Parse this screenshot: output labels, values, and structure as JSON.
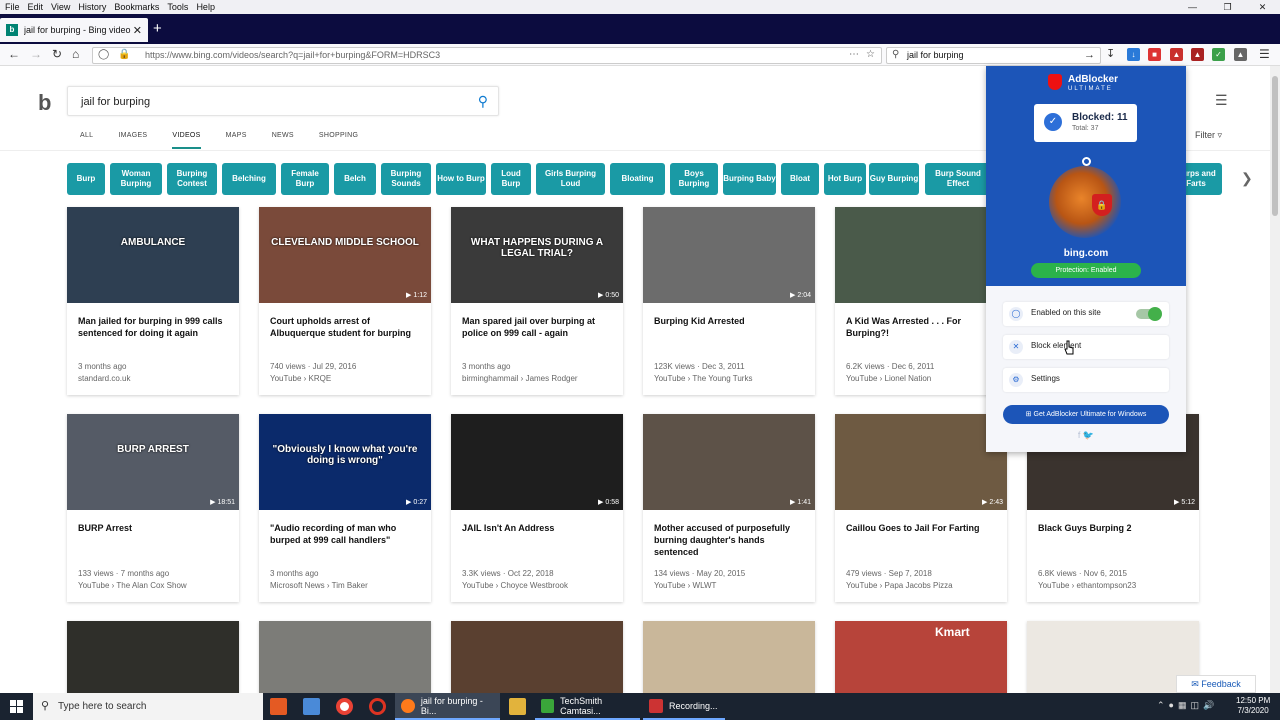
{
  "browser": {
    "menu": [
      "File",
      "Edit",
      "View",
      "History",
      "Bookmarks",
      "Tools",
      "Help"
    ],
    "tab_title": "jail for burping - Bing video",
    "url": "https://www.bing.com/videos/search?q=jail+for+burping&FORM=HDRSC3",
    "search_value": "jail for burping"
  },
  "bing": {
    "query": "jail for burping",
    "scopes": [
      "ALL",
      "IMAGES",
      "VIDEOS",
      "MAPS",
      "NEWS",
      "SHOPPING"
    ],
    "active_scope": "VIDEOS",
    "filter_label": "Filter",
    "pills": [
      {
        "text": "Burp"
      },
      {
        "text": "Woman Burping"
      },
      {
        "text": "Burping Contest"
      },
      {
        "text": "Belching"
      },
      {
        "text": "Female Burp"
      },
      {
        "text": "Belch"
      },
      {
        "text": "Burping Sounds"
      },
      {
        "text": "How to Burp"
      },
      {
        "text": "Loud Burp"
      },
      {
        "text": "Girls Burping Loud"
      },
      {
        "text": "Bloating"
      },
      {
        "text": "Boys Burping"
      },
      {
        "text": "Burping Baby"
      },
      {
        "text": "Bloat"
      },
      {
        "text": "Hot Burp"
      },
      {
        "text": "Guy Burping"
      },
      {
        "text": "Burp Sound Effect"
      },
      {
        "text": "Burps and Farts"
      }
    ],
    "videos": [
      {
        "title": "Man jailed for burping in 999 calls sentenced for doing it again",
        "meta1": "3 months ago",
        "meta2": "standard.co.uk",
        "duration": "",
        "thumb": "#2e3f52",
        "overlay": "AMBULANCE"
      },
      {
        "title": "Court upholds arrest of Albuquerque student for burping",
        "meta1": "740 views · Jul 29, 2016",
        "meta2": "YouTube › KRQE",
        "duration": "1:12",
        "thumb": "#7a4a3a",
        "overlay": "CLEVELAND MIDDLE SCHOOL"
      },
      {
        "title": "Man spared jail over burping at police on 999 call - again",
        "meta1": "3 months ago",
        "meta2": "birminghammail › James Rodger",
        "duration": "0:50",
        "thumb": "#3a3a3a",
        "overlay": "WHAT HAPPENS DURING A LEGAL TRIAL?"
      },
      {
        "title": "Burping Kid Arrested",
        "meta1": "123K views · Dec 3, 2011",
        "meta2": "YouTube › The Young Turks",
        "duration": "2:04",
        "thumb": "#6c6c6c",
        "overlay": ""
      },
      {
        "title": "A Kid Was Arrested . . . For Burping?!",
        "meta1": "6.2K views · Dec 6, 2011",
        "meta2": "YouTube › Lionel Nation",
        "duration": "",
        "thumb": "#4a5a4a",
        "overlay": ""
      },
      {
        "title": "BURP Arrest",
        "meta1": "133 views · 7 months ago",
        "meta2": "YouTube › The Alan Cox Show",
        "duration": "18:51",
        "thumb": "#555b66",
        "overlay": "BURP ARREST"
      },
      {
        "title": "\"Audio recording of man who burped at 999 call handlers\"",
        "meta1": "3 months ago",
        "meta2": "Microsoft News › Tim Baker",
        "duration": "0:27",
        "thumb": "#0b2a6b",
        "overlay": "\"Obviously I know what you're doing is wrong\""
      },
      {
        "title": "JAIL Isn't An Address",
        "meta1": "3.3K views · Oct 22, 2018",
        "meta2": "YouTube › Choyce Westbrook",
        "duration": "0:58",
        "thumb": "#1e1e1e",
        "overlay": ""
      },
      {
        "title": "Mother accused of purposefully burning daughter's hands sentenced",
        "meta1": "134 views · May 20, 2015",
        "meta2": "YouTube › WLWT",
        "duration": "1:41",
        "thumb": "#5d5248",
        "overlay": ""
      },
      {
        "title": "Caillou Goes to Jail For Farting",
        "meta1": "479 views · Sep 7, 2018",
        "meta2": "YouTube › Papa Jacobs Pizza",
        "duration": "2:43",
        "thumb": "#6e5a42",
        "overlay": ""
      },
      {
        "title": "Black Guys Burping 2",
        "meta1": "6.8K views · Nov 6, 2015",
        "meta2": "YouTube › ethantompson23",
        "duration": "5:12",
        "thumb": "#3a332e",
        "overlay": ""
      }
    ],
    "row3_thumbs": [
      "#2f2f2a",
      "#7c7c78",
      "#5a4030",
      "#c9b79a",
      "#b7443a",
      "#ece8e2"
    ],
    "row3_overlay_kmart": "Kmart",
    "feedback": "Feedback"
  },
  "adblocker": {
    "brand": "AdBlocker",
    "brand_sub": "ULTIMATE",
    "blocked": "Blocked: 11",
    "total": "Total: 37",
    "domain": "bing.com",
    "status": "Protection: Enabled",
    "rows": [
      "Enabled on this site",
      "Block element",
      "Settings"
    ],
    "windows_button": "Get AdBlocker Ultimate for Windows",
    "social": "f  🐦"
  },
  "taskbar": {
    "search_placeholder": "Type here to search",
    "apps": [
      "jail for burping - Bi...",
      "TechSmith Camtasi...",
      "Recording..."
    ],
    "time": "12:50 PM",
    "date": "7/3/2020"
  },
  "colors": {
    "pill": "#1a9aa5",
    "adblocker_blue": "#1c55b8",
    "firefox_tabbar": "#0c0c3f"
  }
}
